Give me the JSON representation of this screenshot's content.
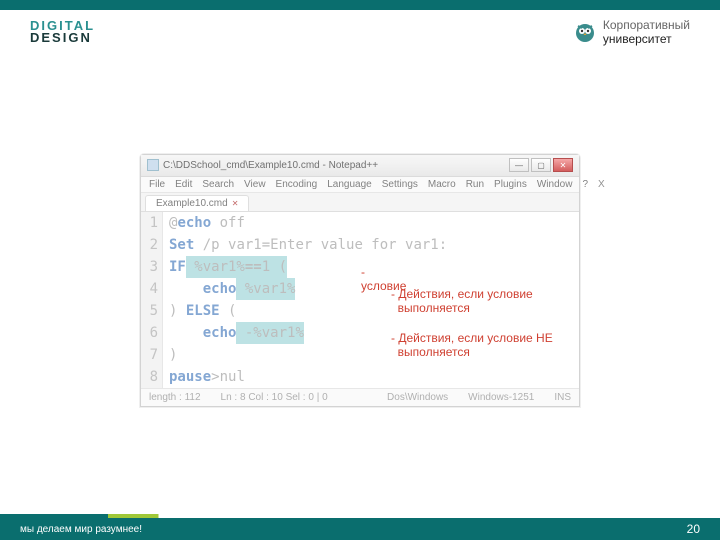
{
  "brand": {
    "line1": "DIGITAL",
    "line2": "DESIGN"
  },
  "corp": {
    "line1": "Корпоративный",
    "line2": "университет"
  },
  "window": {
    "title": "C:\\DDSchool_cmd\\Example10.cmd - Notepad++",
    "menus": [
      "File",
      "Edit",
      "Search",
      "View",
      "Encoding",
      "Language",
      "Settings",
      "Macro",
      "Run",
      "Plugins",
      "Window",
      "?"
    ],
    "menu_close": "X",
    "tab": "Example10.cmd",
    "tab_close": "✕",
    "winbtn_min": "—",
    "winbtn_max": "▢",
    "winbtn_close": "✕"
  },
  "code": {
    "lines": [
      {
        "n": "1",
        "pre": "@",
        "kw": "echo",
        "rest": " off"
      },
      {
        "n": "2",
        "kw": "Set",
        "rest": " /p var1=Enter value for var1:"
      },
      {
        "n": "3",
        "kw": "IF",
        "mid": " %var1%",
        "op": "==",
        "tail": "1 (",
        "hl": true
      },
      {
        "n": "4",
        "indent": "    ",
        "kw": "echo",
        "rest": " %var1%",
        "hlrest": true
      },
      {
        "n": "5",
        "pre": ") ",
        "kw": "ELSE",
        "rest": " ("
      },
      {
        "n": "6",
        "indent": "    ",
        "kw": "echo",
        "rest": " -%var1%",
        "hlrest": true
      },
      {
        "n": "7",
        "pre": ")"
      },
      {
        "n": "8",
        "kw": "pause",
        "rest": ">nul"
      }
    ]
  },
  "status": {
    "len": "length : 112",
    "pos": "Ln : 8    Col : 10    Sel : 0 | 0",
    "eol": "Dos\\Windows",
    "enc": "Windows-1251",
    "ins": "INS"
  },
  "callouts": {
    "c1a": "-",
    "c1b": "условие",
    "c2": "- Действия, если условие",
    "c2b": "выполняется",
    "c3": "- Действия, если условие НЕ",
    "c3b": "выполняется"
  },
  "footer": {
    "tagline": "мы делаем мир разумнее!",
    "page": "20"
  }
}
